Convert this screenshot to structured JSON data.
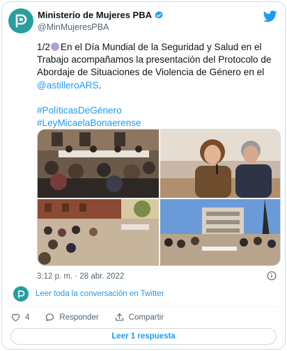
{
  "account": {
    "display_name": "Ministerio de Mujeres PBA",
    "handle": "@MinMujeresPBA",
    "avatar_icon": "ministry-logo-icon",
    "verified_icon": "verified-badge-icon",
    "platform_icon": "twitter-bird-icon"
  },
  "tweet": {
    "prefix": "1/2",
    "emoji": "purple-circle",
    "body_part1": "En el Día Mundial de la Seguridad y Salud en el Trabajo acompañamos la presentación del Protocolo de Abordaje de Situaciones de Violencia de Género en el",
    "mention": "@astilleroARS",
    "period": ".",
    "hashtag1": "#PolíticasDeGénero",
    "hashtag2": "#LeyMicaelaBonaerense",
    "timestamp": "3:12 p. m. · 28 abr. 2022"
  },
  "conversation_link": "Leer toda la conversación en Twitter",
  "actions": {
    "like_count": "4",
    "reply_label": "Responder",
    "share_label": "Compartir"
  },
  "read_replies_button": "Leer 1 respuesta",
  "colors": {
    "accent": "#1d9bf0",
    "avatar": "#2a9d9f",
    "emoji": "#b39ddb"
  }
}
